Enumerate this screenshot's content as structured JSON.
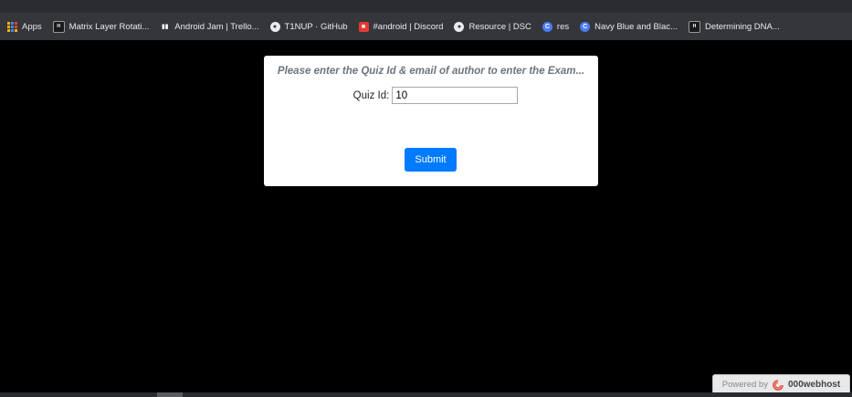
{
  "bookmarks": [
    {
      "label": "Apps",
      "icon": "apps-grid-icon"
    },
    {
      "label": "Matrix Layer Rotati...",
      "icon": "hackerrank-icon",
      "glyph": "H"
    },
    {
      "label": "Android Jam | Trello...",
      "icon": "trello-icon",
      "glyph": "▮▮"
    },
    {
      "label": "T1NUP · GitHub",
      "icon": "github-icon",
      "glyph": "●"
    },
    {
      "label": "#android | Discord",
      "icon": "discord-icon",
      "glyph": "■"
    },
    {
      "label": "Resource | DSC",
      "icon": "github-icon",
      "glyph": "●"
    },
    {
      "label": "res",
      "icon": "c-icon",
      "glyph": "C"
    },
    {
      "label": "Navy Blue and Blac...",
      "icon": "c-icon",
      "glyph": "C"
    },
    {
      "label": "Determining DNA...",
      "icon": "hackerrank-icon",
      "glyph": "H"
    }
  ],
  "form": {
    "heading": "Please enter the Quiz Id & email of author to enter the Exam...",
    "quiz_id_label": "Quiz Id:",
    "quiz_id_value": "10",
    "submit_label": "Submit"
  },
  "footer": {
    "powered_by": "Powered by",
    "brand": "000webhost"
  },
  "colors": {
    "page_bg": "#000000",
    "card_bg": "#ffffff",
    "submit_bg": "#007bff",
    "heading_color": "#6c757d",
    "bookmarks_bar_bg": "#35363a"
  }
}
